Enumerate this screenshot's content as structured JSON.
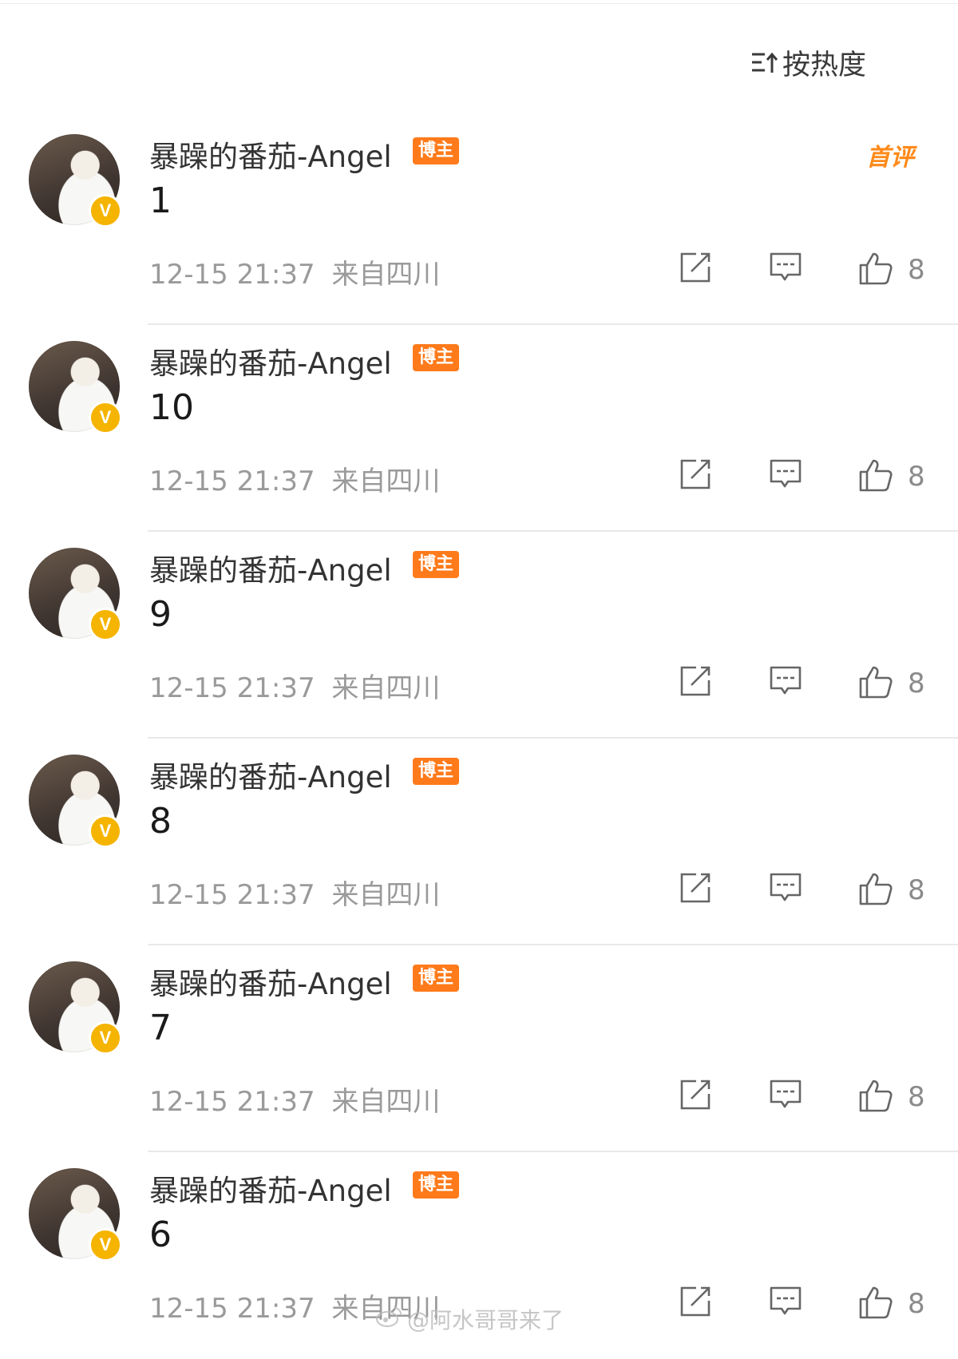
{
  "sort": {
    "label": "按热度",
    "icon": "sort-icon"
  },
  "comments": [
    {
      "username": "暴躁的番茄-Angel",
      "tag": "博主",
      "first_tag": "首评",
      "text": "1",
      "time": "12-15 21:37",
      "location": "来自四川",
      "likes": "8"
    },
    {
      "username": "暴躁的番茄-Angel",
      "tag": "博主",
      "first_tag": "",
      "text": "10",
      "time": "12-15 21:37",
      "location": "来自四川",
      "likes": "8"
    },
    {
      "username": "暴躁的番茄-Angel",
      "tag": "博主",
      "first_tag": "",
      "text": "9",
      "time": "12-15 21:37",
      "location": "来自四川",
      "likes": "8"
    },
    {
      "username": "暴躁的番茄-Angel",
      "tag": "博主",
      "first_tag": "",
      "text": "8",
      "time": "12-15 21:37",
      "location": "来自四川",
      "likes": "8"
    },
    {
      "username": "暴躁的番茄-Angel",
      "tag": "博主",
      "first_tag": "",
      "text": "7",
      "time": "12-15 21:37",
      "location": "来自四川",
      "likes": "8"
    },
    {
      "username": "暴躁的番茄-Angel",
      "tag": "博主",
      "first_tag": "",
      "text": "6",
      "time": "12-15 21:37",
      "location": "来自四川",
      "likes": "8"
    }
  ],
  "watermark": "@阿水哥哥来了",
  "colors": {
    "tag": "#ff7a1a",
    "verified": "#f5b400",
    "meta": "#9a9a9a"
  }
}
